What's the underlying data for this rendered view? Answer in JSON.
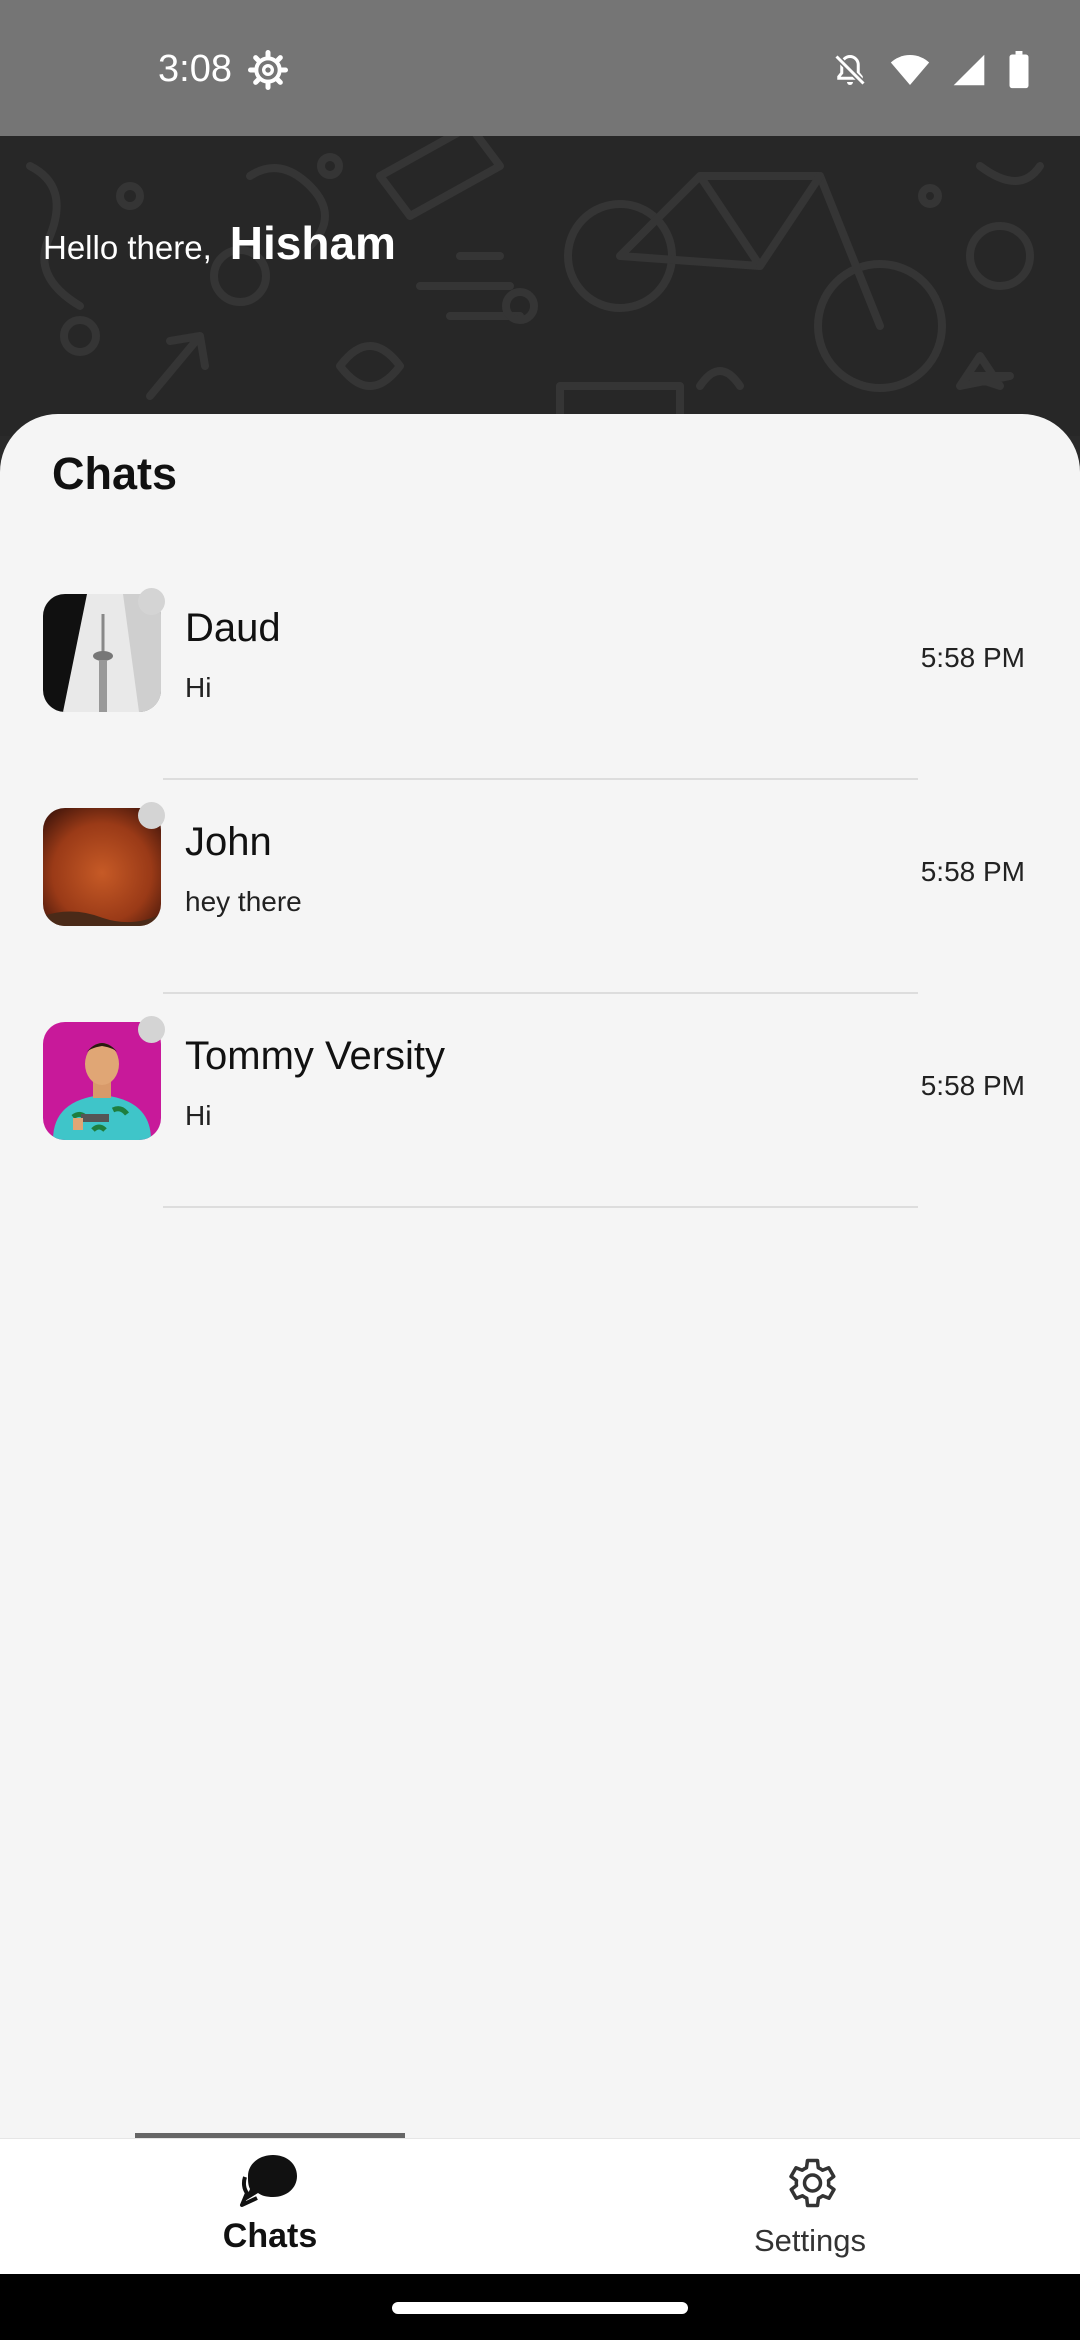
{
  "status_bar": {
    "time": "3:08",
    "icons": [
      "settings-gear-icon",
      "notifications-off-icon",
      "wifi-icon",
      "cellular-signal-icon",
      "battery-icon"
    ]
  },
  "header": {
    "greeting": "Hello there,",
    "user_name": "Hisham"
  },
  "chats": {
    "title": "Chats",
    "items": [
      {
        "name": "Daud",
        "last_message": "Hi",
        "time": "5:58 PM",
        "avatar": "tower-photo"
      },
      {
        "name": "John",
        "last_message": "hey there",
        "time": "5:58 PM",
        "avatar": "orange-sky-photo"
      },
      {
        "name": "Tommy Versity",
        "last_message": "Hi",
        "time": "5:58 PM",
        "avatar": "character-illustration"
      }
    ]
  },
  "bottom_nav": {
    "active": "Chats",
    "chats_label": "Chats",
    "settings_label": "Settings"
  },
  "colors": {
    "status_bar": "#757575",
    "header_bg": "#272727",
    "panel_bg": "#f5f5f5",
    "presence_dot": "#d4d4d4"
  }
}
